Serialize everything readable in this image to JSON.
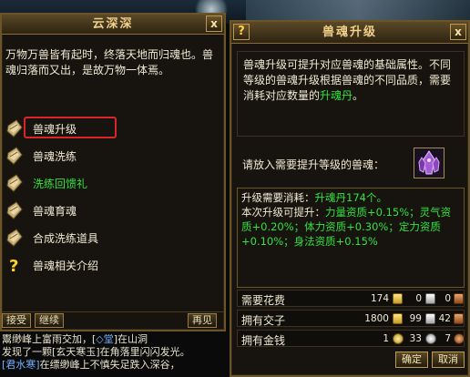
{
  "left_panel": {
    "title": "云深深",
    "close": "x",
    "intro": "万物万兽皆有起时，终落天地而归魂也。兽魂归落而又出，是故万物一体焉。",
    "menu": [
      {
        "label": "兽魂升级",
        "color": "#f0ead4",
        "icon": "scroll-icon",
        "selected": true
      },
      {
        "label": "兽魂洗练",
        "color": "#f0ead4",
        "icon": "scroll-icon",
        "selected": false
      },
      {
        "label": "洗练回馈礼",
        "color": "#32e23f",
        "icon": "scroll-icon",
        "selected": false
      },
      {
        "label": "兽魂育魂",
        "color": "#f0ead4",
        "icon": "scroll-icon",
        "selected": false
      },
      {
        "label": "合成洗练道具",
        "color": "#f0ead4",
        "icon": "scroll-icon",
        "selected": false
      },
      {
        "label": "兽魂相关介绍",
        "color": "#f0ead4",
        "icon": "question-icon",
        "selected": false
      }
    ],
    "buttons": {
      "accept": "接受",
      "continue": "继续",
      "goodbye": "再见"
    }
  },
  "chat": {
    "line1": "鬻缈峰上富雨交加，[",
    "line1_link": "◇堂",
    "line1_tail": "]在山洞",
    "line2": "发现了一颗[玄天寒玉]在角落里闪闪发光。",
    "line3_link": "[君水寒]",
    "line3_tail": "在缥缈峰上不慎失足跌入深谷，"
  },
  "right_panel": {
    "title": "兽魂升级",
    "help": "?",
    "close": "x",
    "description_main": "兽魂升级可提升对应兽魂的基础属性。不同等级的兽魂升级根据兽魂的不同品质，需要消耗对应数量的",
    "description_highlight": "升魂丹",
    "description_end": "。",
    "slot_prompt": "请放入需要提升等级的兽魂：",
    "slot_icon": "purple-crystal-icon",
    "info_cost_label": "升级需要消耗：",
    "info_cost_value": "升魂丹174个。",
    "info_boost_label": "本次升级可提升：",
    "info_boost_value": "力量资质+0.15%；灵气资质+0.20%；体力资质+0.30%；定力资质+0.10%；身法资质+0.15%",
    "costs": {
      "label": "需要花费",
      "gold": "174",
      "silver": "0",
      "copper": "0"
    },
    "owned_jiaozi": {
      "label": "拥有交子",
      "gold": "1800",
      "silver": "99",
      "copper": "42"
    },
    "owned_money": {
      "label": "拥有金钱",
      "gold": "1",
      "silver": "33",
      "copper": "7"
    },
    "buttons": {
      "confirm": "确定",
      "cancel": "取消"
    }
  },
  "colors": {
    "accent_gold": "#f1d08a",
    "highlight_green": "#32e23f",
    "selection_red": "#d9242a"
  }
}
